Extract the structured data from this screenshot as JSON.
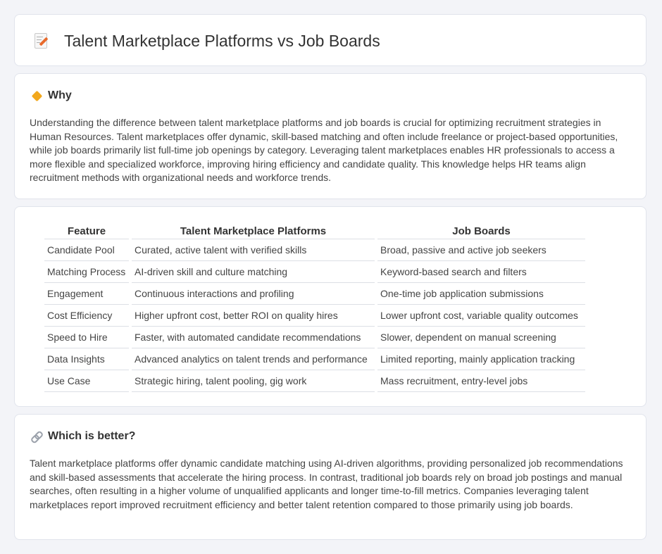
{
  "header": {
    "title": "Talent Marketplace Platforms vs Job Boards",
    "icon": "document-pencil-icon"
  },
  "why": {
    "icon": "warning-diamond-icon",
    "title": "Why",
    "text": "Understanding the difference between talent marketplace platforms and job boards is crucial for optimizing recruitment strategies in Human Resources. Talent marketplaces offer dynamic, skill-based matching and often include freelance or project-based opportunities, while job boards primarily list full-time job openings by category. Leveraging talent marketplaces enables HR professionals to access a more flexible and specialized workforce, improving hiring efficiency and candidate quality. This knowledge helps HR teams align recruitment methods with organizational needs and workforce trends."
  },
  "table": {
    "headers": [
      "Feature",
      "Talent Marketplace Platforms",
      "Job Boards"
    ],
    "rows": [
      [
        "Candidate Pool",
        "Curated, active talent with verified skills",
        "Broad, passive and active job seekers"
      ],
      [
        "Matching Process",
        "AI-driven skill and culture matching",
        "Keyword-based search and filters"
      ],
      [
        "Engagement",
        "Continuous interactions and profiling",
        "One-time job application submissions"
      ],
      [
        "Cost Efficiency",
        "Higher upfront cost, better ROI on quality hires",
        "Lower upfront cost, variable quality outcomes"
      ],
      [
        "Speed to Hire",
        "Faster, with automated candidate recommendations",
        "Slower, dependent on manual screening"
      ],
      [
        "Data Insights",
        "Advanced analytics on talent trends and performance",
        "Limited reporting, mainly application tracking"
      ],
      [
        "Use Case",
        "Strategic hiring, talent pooling, gig work",
        "Mass recruitment, entry-level jobs"
      ]
    ]
  },
  "better": {
    "icon": "link-icon",
    "title": "Which is better?",
    "text": "Talent marketplace platforms offer dynamic candidate matching using AI-driven algorithms, providing personalized job recommendations and skill-based assessments that accelerate the hiring process. In contrast, traditional job boards rely on broad job postings and manual searches, often resulting in a higher volume of unqualified applicants and longer time-to-fill metrics. Companies leveraging talent marketplaces report improved recruitment efficiency and better talent retention compared to those primarily using job boards."
  },
  "colors": {
    "background": "#f3f4f8",
    "card": "#ffffff",
    "accent_orange": "#e86a2c",
    "diamond_yellow": "#f2a81d"
  }
}
